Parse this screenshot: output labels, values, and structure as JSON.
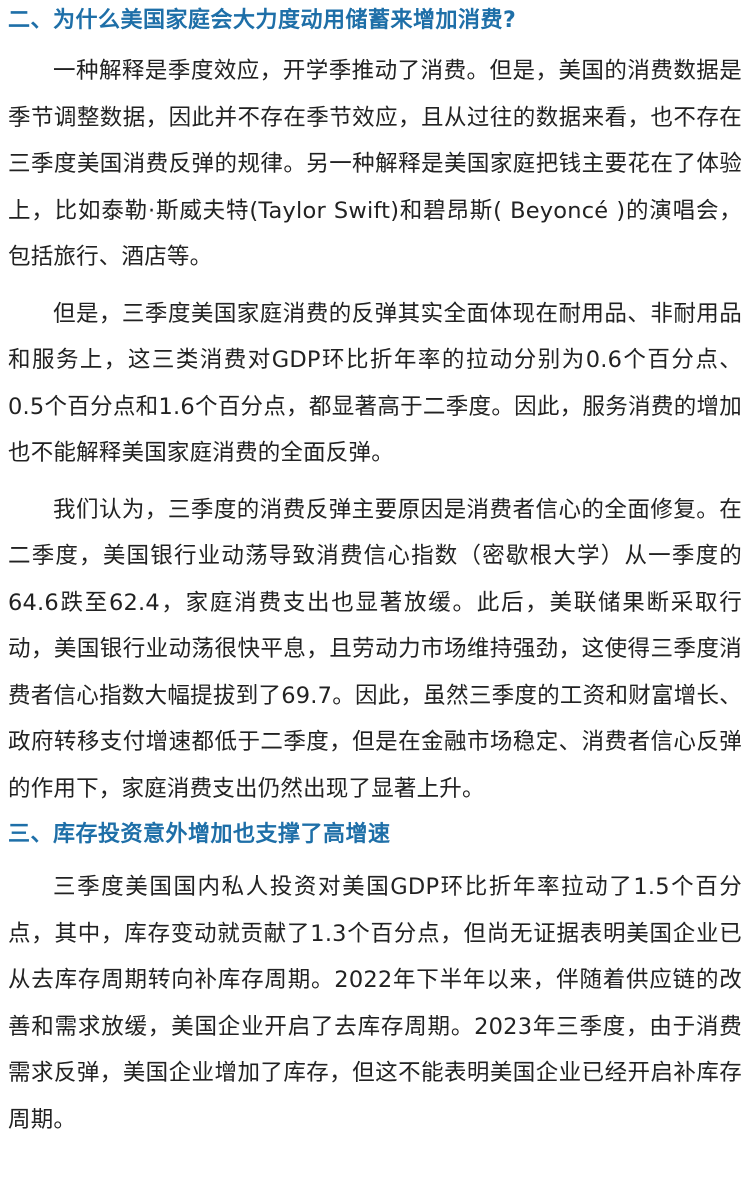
{
  "article": {
    "section2": {
      "heading": "二、为什么美国家庭会大力度动用储蓄来增加消费?",
      "paragraphs": [
        "一种解释是季度效应，开学季推动了消费。但是，美国的消费数据是季节调整数据，因此并不存在季节效应，且从过往的数据来看，也不存在三季度美国消费反弹的规律。另一种解释是美国家庭把钱主要花在了体验上，比如泰勒·斯威夫特(Taylor Swift)和碧昂斯( Beyoncé )的演唱会，包括旅行、酒店等。",
        "但是，三季度美国家庭消费的反弹其实全面体现在耐用品、非耐用品和服务上，这三类消费对GDP环比折年率的拉动分别为0.6个百分点、0.5个百分点和1.6个百分点，都显著高于二季度。因此，服务消费的增加也不能解释美国家庭消费的全面反弹。",
        "我们认为，三季度的消费反弹主要原因是消费者信心的全面修复。在二季度，美国银行业动荡导致消费信心指数（密歇根大学）从一季度的64.6跌至62.4，家庭消费支出也显著放缓。此后，美联储果断采取行动，美国银行业动荡很快平息，且劳动力市场维持强劲，这使得三季度消费者信心指数大幅提拔到了69.7。因此，虽然三季度的工资和财富增长、政府转移支付增速都低于二季度，但是在金融市场稳定、消费者信心反弹的作用下，家庭消费支出仍然出现了显著上升。"
      ]
    },
    "section3": {
      "heading": "三、库存投资意外增加也支撑了高增速",
      "paragraphs": [
        "三季度美国国内私人投资对美国GDP环比折年率拉动了1.5个百分点，其中，库存变动就贡献了1.3个百分点，但尚无证据表明美国企业已从去库存周期转向补库存周期。2022年下半年以来，伴随着供应链的改善和需求放缓，美国企业开启了去库存周期。2023年三季度，由于消费需求反弹，美国企业增加了库存，但这不能表明美国企业已经开启补库存周期。"
      ]
    },
    "colors": {
      "heading": "#1e6fa8",
      "body_text": "#222222",
      "background": "#ffffff"
    }
  }
}
